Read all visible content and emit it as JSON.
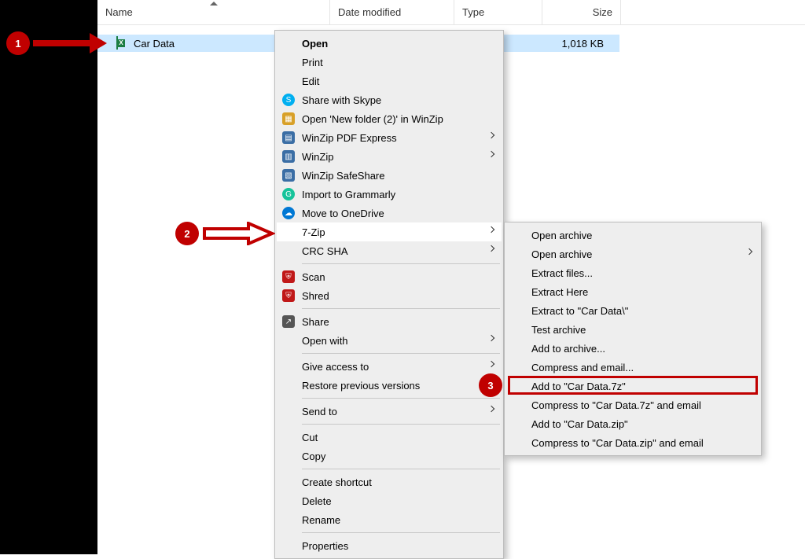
{
  "headers": {
    "name": "Name",
    "date": "Date modified",
    "type": "Type",
    "size": "Size"
  },
  "file": {
    "name": "Car Data",
    "type": "xcel Co...",
    "size": "1,018 KB"
  },
  "context_menu": [
    {
      "label": "Open",
      "bold": true
    },
    {
      "label": "Print"
    },
    {
      "label": "Edit"
    },
    {
      "label": "Share with Skype",
      "icon": "skype"
    },
    {
      "label": "Open 'New folder (2)' in WinZip",
      "icon": "winzip-folder"
    },
    {
      "label": "WinZip PDF Express",
      "icon": "pdf",
      "submenu": true
    },
    {
      "label": "WinZip",
      "icon": "winzip",
      "submenu": true
    },
    {
      "label": "WinZip SafeShare",
      "icon": "winzip-safe"
    },
    {
      "label": "Import to Grammarly",
      "icon": "grammarly"
    },
    {
      "label": "Move to OneDrive",
      "icon": "onedrive"
    },
    {
      "label": "7-Zip",
      "submenu": true,
      "highlight": true
    },
    {
      "label": "CRC SHA",
      "submenu": true
    },
    {
      "sep": true
    },
    {
      "label": "Scan",
      "icon": "mcafee"
    },
    {
      "label": "Shred",
      "icon": "mcafee"
    },
    {
      "sep": true
    },
    {
      "label": "Share",
      "icon": "share"
    },
    {
      "label": "Open with",
      "submenu": true
    },
    {
      "sep": true
    },
    {
      "label": "Give access to",
      "submenu": true
    },
    {
      "label": "Restore previous versions"
    },
    {
      "sep": true
    },
    {
      "label": "Send to",
      "submenu": true
    },
    {
      "sep": true
    },
    {
      "label": "Cut"
    },
    {
      "label": "Copy"
    },
    {
      "sep": true
    },
    {
      "label": "Create shortcut"
    },
    {
      "label": "Delete"
    },
    {
      "label": "Rename"
    },
    {
      "sep": true
    },
    {
      "label": "Properties"
    }
  ],
  "sub_menu": [
    {
      "label": "Open archive"
    },
    {
      "label": "Open archive",
      "submenu": true
    },
    {
      "label": "Extract files..."
    },
    {
      "label": "Extract Here"
    },
    {
      "label": "Extract to \"Car Data\\\""
    },
    {
      "label": "Test archive"
    },
    {
      "label": "Add to archive..."
    },
    {
      "label": "Compress and email..."
    },
    {
      "label": "Add to \"Car Data.7z\"",
      "boxed": true
    },
    {
      "label": "Compress to \"Car Data.7z\" and email"
    },
    {
      "label": "Add to \"Car Data.zip\""
    },
    {
      "label": "Compress to \"Car Data.zip\" and email"
    }
  ],
  "callouts": {
    "one": "1",
    "two": "2",
    "three": "3"
  }
}
